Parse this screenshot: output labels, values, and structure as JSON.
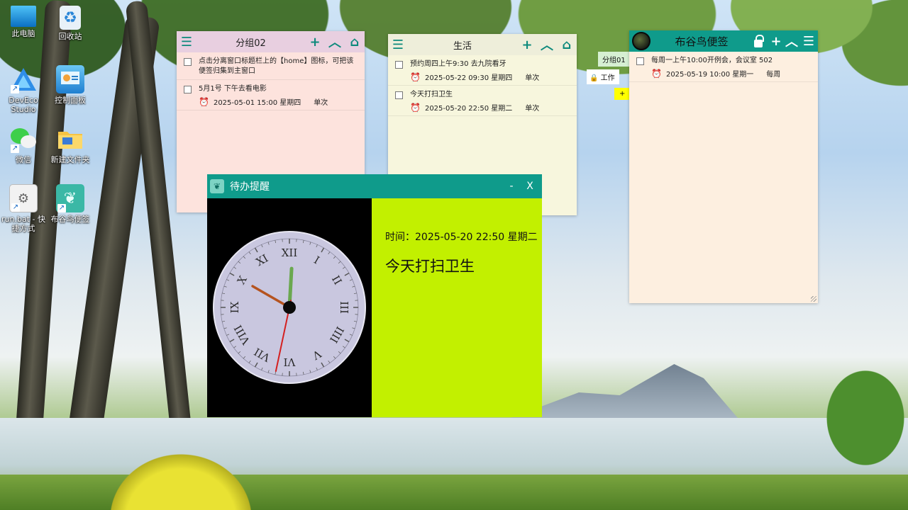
{
  "desktop": {
    "icons": [
      {
        "label": "此电脑",
        "icon": "monitor-icon"
      },
      {
        "label": "回收站",
        "icon": "recycle-bin-icon"
      },
      {
        "label": "DevEco Studio",
        "icon": "deveco-icon"
      },
      {
        "label": "控制面板",
        "icon": "control-panel-icon"
      },
      {
        "label": "微信",
        "icon": "wechat-icon"
      },
      {
        "label": "新建文件夹",
        "icon": "folder-icon"
      },
      {
        "label": "run.bat - 快捷方式",
        "icon": "batch-file-icon"
      },
      {
        "label": "布谷鸟便签",
        "icon": "cuckoo-note-icon"
      }
    ]
  },
  "group_window_1": {
    "title": "分组02",
    "items": [
      {
        "text": "点击分离窗口标题栏上的【home】图标，可把该便签归集到主窗口",
        "datetime": "",
        "repeat": ""
      },
      {
        "text": "5月1号 下午去看电影",
        "datetime": "2025-05-01 15:00 星期四",
        "repeat": "单次"
      }
    ]
  },
  "group_window_2": {
    "title": "生活",
    "items": [
      {
        "text": "预约周四上午9:30 去九院看牙",
        "datetime": "2025-05-22 09:30 星期四",
        "repeat": "单次"
      },
      {
        "text": "今天打扫卫生",
        "datetime": "2025-05-20 22:50 星期二",
        "repeat": "单次"
      }
    ]
  },
  "main_window": {
    "title": "布谷鸟便签",
    "side_tabs": [
      "分组01",
      "工作",
      "+"
    ],
    "items": [
      {
        "text": "每周一上午10:00开例会，会议室 502",
        "datetime": "2025-05-19 10:00 星期一",
        "repeat": "每周"
      }
    ]
  },
  "reminder": {
    "title": "待办提醒",
    "minimize": "-",
    "close": "X",
    "time_label": "时间：2025-05-20 22:50 星期二",
    "task": "今天打扫卫生",
    "clock_numerals": [
      "XII",
      "I",
      "II",
      "III",
      "IIII",
      "V",
      "VI",
      "VII",
      "VIII",
      "IX",
      "X",
      "XI"
    ],
    "clock_time": {
      "hour": 10,
      "minute": 0,
      "second": 32
    }
  },
  "colors": {
    "accent": "#0f9b8b",
    "reminder_bg": "#c2f000",
    "note_pink": "#fde3dd",
    "note_cream": "#f7f6dd",
    "note_peach": "#fdefe0"
  }
}
